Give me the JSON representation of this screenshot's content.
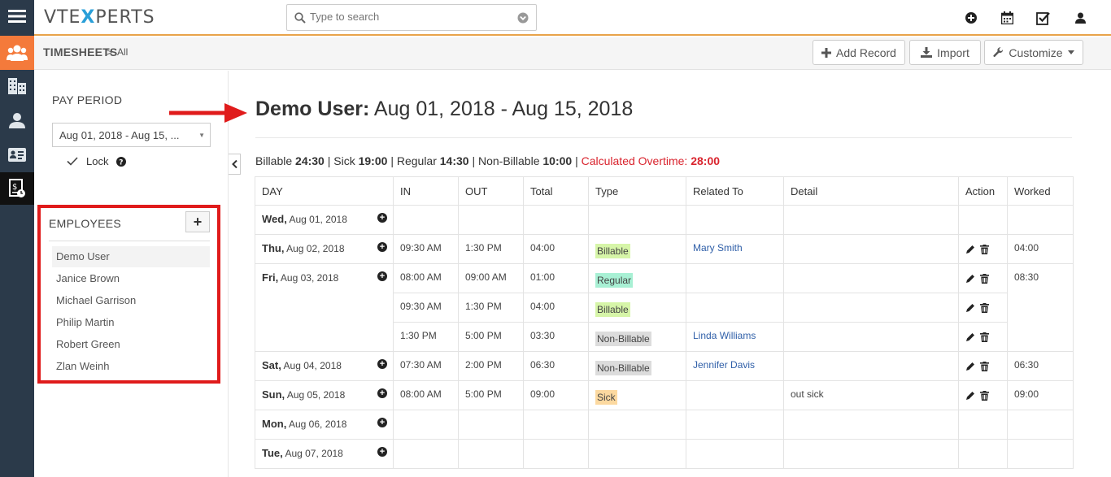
{
  "app": {
    "logo_prefix": "VTE",
    "logo_x": "X",
    "logo_suffix": "PERTS"
  },
  "search": {
    "placeholder": "Type to search"
  },
  "breadcrumb": {
    "module": "TIMESHEETS",
    "separator": ">",
    "view": "All"
  },
  "toolbar": {
    "add_record": "Add Record",
    "import": "Import",
    "customize": "Customize"
  },
  "sidebar": {
    "pay_period_label": "PAY PERIOD",
    "pay_period_value": "Aug 01, 2018 - Aug 15, ...",
    "lock_label": "Lock",
    "employees_label": "EMPLOYEES",
    "add_label": "+",
    "employees": [
      "Demo User",
      "Janice Brown",
      "Michael Garrison",
      "Philip Martin",
      "Robert Green",
      "Zlan Weinh"
    ]
  },
  "main": {
    "user": "Demo User:",
    "range": "Aug 01, 2018 - Aug 15, 2018",
    "summary": {
      "billable_label": "Billable",
      "billable": "24:30",
      "sick_label": "Sick",
      "sick": "19:00",
      "regular_label": "Regular",
      "regular": "14:30",
      "nonbillable_label": "Non-Billable",
      "nonbillable": "10:00",
      "overtime_label": "Calculated Overtime:",
      "overtime": "28:00",
      "sep": "|"
    },
    "columns": [
      "DAY",
      "IN",
      "OUT",
      "Total",
      "Type",
      "Related To",
      "Detail",
      "Action",
      "Worked"
    ],
    "days": [
      {
        "dow": "Wed,",
        "date": "Aug 01, 2018"
      },
      {
        "dow": "Thu,",
        "date": "Aug 02, 2018"
      },
      {
        "dow": "Fri,",
        "date": "Aug 03, 2018"
      },
      {
        "dow": "Sat,",
        "date": "Aug 04, 2018"
      },
      {
        "dow": "Sun,",
        "date": "Aug 05, 2018"
      },
      {
        "dow": "Mon,",
        "date": "Aug 06, 2018"
      },
      {
        "dow": "Tue,",
        "date": "Aug 07, 2018"
      }
    ],
    "entries": [
      {
        "in": "09:30 AM",
        "out": "1:30 PM",
        "total": "04:00",
        "type": "Billable",
        "related": "Mary Smith",
        "detail": "",
        "worked": "04:00"
      },
      {
        "in": "08:00 AM",
        "out": "09:00 AM",
        "total": "01:00",
        "type": "Regular",
        "related": "",
        "detail": "",
        "worked": "08:30"
      },
      {
        "in": "09:30 AM",
        "out": "1:30 PM",
        "total": "04:00",
        "type": "Billable",
        "related": "",
        "detail": ""
      },
      {
        "in": "1:30 PM",
        "out": "5:00 PM",
        "total": "03:30",
        "type": "Non-Billable",
        "related": "Linda Williams",
        "detail": ""
      },
      {
        "in": "07:30 AM",
        "out": "2:00 PM",
        "total": "06:30",
        "type": "Non-Billable",
        "related": "Jennifer Davis",
        "detail": "",
        "worked": "06:30"
      },
      {
        "in": "08:00 AM",
        "out": "5:00 PM",
        "total": "09:00",
        "type": "Sick",
        "related": "",
        "detail": "out sick",
        "worked": "09:00"
      }
    ]
  },
  "colors": {
    "accent_orange": "#f47a3b",
    "highlight_red": "#e01b1b",
    "overtime": "#d9232d",
    "link": "#2f5fa8"
  }
}
